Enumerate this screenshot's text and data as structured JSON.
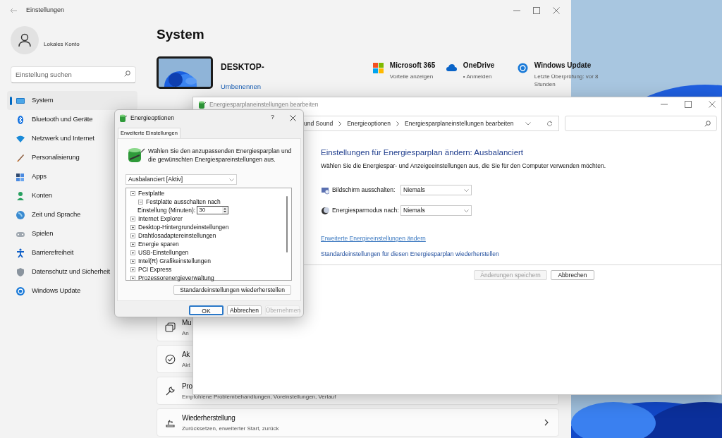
{
  "settings_window": {
    "title": "Einstellungen",
    "account": {
      "type": "Lokales Konto"
    },
    "search": {
      "placeholder": "Einstellung suchen"
    },
    "nav": [
      {
        "label": "System",
        "selected": true
      },
      {
        "label": "Bluetooth und Geräte",
        "selected": false
      },
      {
        "label": "Netzwerk und Internet",
        "selected": false
      },
      {
        "label": "Personalisierung",
        "selected": false
      },
      {
        "label": "Apps",
        "selected": false
      },
      {
        "label": "Konten",
        "selected": false
      },
      {
        "label": "Zeit und Sprache",
        "selected": false
      },
      {
        "label": "Spielen",
        "selected": false
      },
      {
        "label": "Barrierefreiheit",
        "selected": false
      },
      {
        "label": "Datenschutz und Sicherheit",
        "selected": false
      },
      {
        "label": "Windows Update",
        "selected": false
      }
    ],
    "page_title": "System",
    "device": {
      "name": "DESKTOP-",
      "rename_link": "Umbenennen"
    },
    "tiles": [
      {
        "title": "Microsoft 365",
        "subtitle": "Vorteile anzeigen"
      },
      {
        "title": "OneDrive",
        "subtitle": "• Anmelden"
      },
      {
        "title": "Windows Update",
        "subtitle": "Letzte Überprüfung: vor 8 Stunden"
      }
    ],
    "cards": [
      {
        "title": "Mu",
        "subtitle": "An"
      },
      {
        "title": "Ak",
        "subtitle": "Akt"
      },
      {
        "title": "Pro",
        "subtitle": "Empfohlene Problembehandlungen, Voreinstellungen, Verlauf"
      },
      {
        "title": "Wiederherstellung",
        "subtitle": "Zurücksetzen, erweiterter Start, zurück"
      }
    ]
  },
  "control_panel_window": {
    "title": "Energiesparplaneinstellungen bearbeiten",
    "breadcrumb": [
      "und Sound",
      "Energieoptionen",
      "Energiesparplaneinstellungen bearbeiten"
    ],
    "heading": "Einstellungen für Energiesparplan ändern: Ausbalanciert",
    "description": "Wählen Sie die Energiespar- und Anzeigeeinstellungen aus, die Sie für den Computer verwenden möchten.",
    "settings": [
      {
        "label": "Bildschirm ausschalten:",
        "value": "Niemals"
      },
      {
        "label": "Energiesparmodus nach:",
        "value": "Niemals"
      }
    ],
    "links": [
      "Erweiterte Energieeinstellungen ändern",
      "Standardeinstellungen für diesen Energiesparplan wiederherstellen"
    ],
    "buttons": [
      {
        "label": "Änderungen speichern",
        "disabled": true
      },
      {
        "label": "Abbrechen",
        "disabled": false
      }
    ]
  },
  "dialog": {
    "title": "Energieoptionen",
    "help": "?",
    "tabs": [
      {
        "label": "Erweiterte Einstellungen",
        "selected": true
      }
    ],
    "intro": "Wählen Sie den anzupassenden Energiesparplan und die gewünschten Energiespareinstellungen aus.",
    "plan": "Ausbalanciert [Aktiv]",
    "tree": [
      {
        "label": "Festplatte",
        "expanded": true,
        "children": [
          {
            "label": "Festplatte ausschalten nach",
            "expanded": true,
            "children": [
              {
                "kind": "setting",
                "label": "Einstellung (Minuten):",
                "value": "30"
              }
            ]
          }
        ]
      },
      {
        "label": "Internet Explorer",
        "expanded": false
      },
      {
        "label": "Desktop-Hintergrundeinstellungen",
        "expanded": false
      },
      {
        "label": "Drahtlosadaptereinstellungen",
        "expanded": false
      },
      {
        "label": "Energie sparen",
        "expanded": false
      },
      {
        "label": "USB-Einstellungen",
        "expanded": false
      },
      {
        "label": "Intel(R) Grafikeinstellungen",
        "expanded": false
      },
      {
        "label": "PCI Express",
        "expanded": false
      },
      {
        "label": "Prozessorenergieverwaltung",
        "expanded": false
      }
    ],
    "restore_button": "Standardeinstellungen wiederherstellen",
    "buttons": [
      {
        "label": "OK",
        "focused": true,
        "disabled": false
      },
      {
        "label": "Abbrechen",
        "focused": false,
        "disabled": false
      },
      {
        "label": "Übernehmen",
        "focused": false,
        "disabled": true
      }
    ]
  }
}
